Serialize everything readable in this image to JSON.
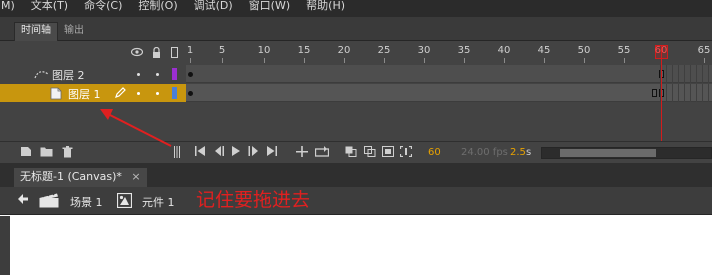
{
  "menubar": {
    "items": [
      "M)",
      "文本(T)",
      "命令(C)",
      "控制(O)",
      "调试(D)",
      "窗口(W)",
      "帮助(H)"
    ]
  },
  "panel_tabs": [
    {
      "label": "时间轴",
      "active": true
    },
    {
      "label": "输出",
      "active": false
    }
  ],
  "timeline": {
    "header_icons": [
      "eye-icon",
      "lock-icon",
      "outline-icon"
    ],
    "ruler": {
      "labels": [
        "1",
        "5",
        "10",
        "15",
        "20",
        "25",
        "30",
        "35",
        "40",
        "45",
        "50",
        "55",
        "60",
        "65"
      ],
      "current_frame": "60"
    },
    "layers": [
      {
        "name": "图层 2",
        "type": "guide",
        "selected": false,
        "color": "#9b2fd1"
      },
      {
        "name": "图层 1",
        "type": "normal",
        "selected": true,
        "color": "#4a7fd8"
      }
    ],
    "footer": {
      "current_frame": "60",
      "fps": "24.00 fps",
      "time": "2.5",
      "time_unit": "s"
    }
  },
  "document_tab": {
    "title": "无标题-1 (Canvas)*",
    "close": "×"
  },
  "edit_bar": {
    "scene_label": "场景 1",
    "symbol_label": "元件 1"
  },
  "annotation": {
    "text": "记住要拖进去",
    "color": "#e02020"
  },
  "colors": {
    "selected_layer": "#c8960e",
    "playhead": "#d31c1c",
    "panel_bg": "#434343"
  }
}
